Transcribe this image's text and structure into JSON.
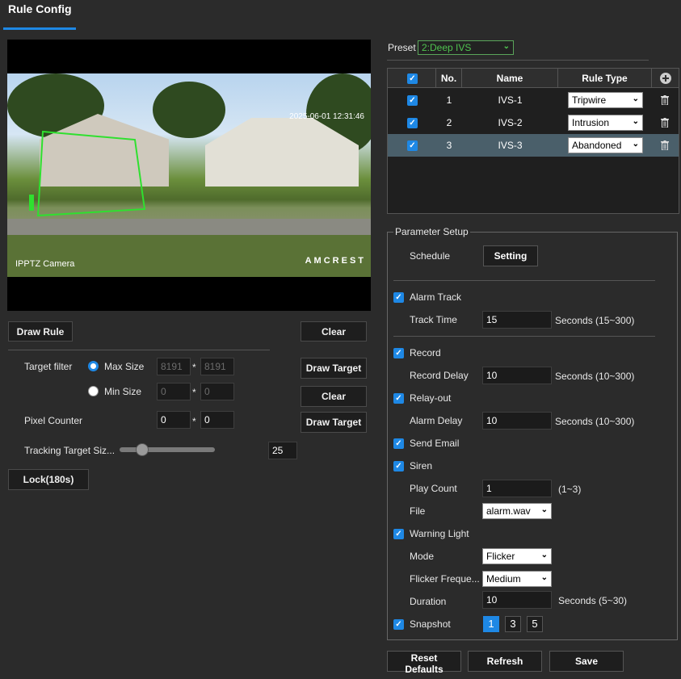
{
  "tab": {
    "title": "Rule Config"
  },
  "video": {
    "timestamp": "2025-06-01 12:31:46",
    "camera_name": "IPPTZ Camera",
    "logo": "AMCREST"
  },
  "left": {
    "draw_rule": "Draw Rule",
    "clear1": "Clear",
    "target_filter_label": "Target filter",
    "max_size_label": "Max Size",
    "min_size_label": "Min Size",
    "max_w": "8191",
    "max_h": "8191",
    "min_w": "0",
    "min_h": "0",
    "times": "*",
    "draw_target1": "Draw Target",
    "clear2": "Clear",
    "pixel_counter_label": "Pixel Counter",
    "pix_w": "0",
    "pix_h": "0",
    "draw_target2": "Draw Target",
    "tracking_label": "Tracking Target Siz...",
    "tracking_value": "25",
    "tracking_slider_fraction": 0.2,
    "lock_button": "Lock(180s)"
  },
  "preset": {
    "label": "Preset",
    "value": "2:Deep IVS"
  },
  "table": {
    "headers": {
      "no": "No.",
      "name": "Name",
      "type": "Rule Type"
    },
    "rows": [
      {
        "no": "1",
        "name": "IVS-1",
        "type": "Tripwire"
      },
      {
        "no": "2",
        "name": "IVS-2",
        "type": "Intrusion"
      },
      {
        "no": "3",
        "name": "IVS-3",
        "type": "Abandoned"
      }
    ]
  },
  "params": {
    "legend": "Parameter Setup",
    "schedule_label": "Schedule",
    "setting_btn": "Setting",
    "alarm_track": "Alarm Track",
    "track_time_label": "Track Time",
    "track_time": "15",
    "track_time_unit": "Seconds (15~300)",
    "record": "Record",
    "record_delay_label": "Record Delay",
    "record_delay": "10",
    "record_delay_unit": "Seconds (10~300)",
    "relay_out": "Relay-out",
    "alarm_delay_label": "Alarm Delay",
    "alarm_delay": "10",
    "alarm_delay_unit": "Seconds (10~300)",
    "send_email": "Send Email",
    "siren": "Siren",
    "play_count_label": "Play Count",
    "play_count": "1",
    "play_count_unit": "(1~3)",
    "file_label": "File",
    "file_value": "alarm.wav",
    "warning_light": "Warning Light",
    "mode_label": "Mode",
    "mode_value": "Flicker",
    "flicker_label": "Flicker Freque...",
    "flicker_value": "Medium",
    "duration_label": "Duration",
    "duration": "10",
    "duration_unit": "Seconds (5~30)",
    "snapshot": "Snapshot",
    "snap_options": [
      "1",
      "3",
      "5"
    ]
  },
  "footer": {
    "reset": "Reset Defaults",
    "refresh": "Refresh",
    "save": "Save"
  },
  "colors": {
    "accent": "#1e88e5",
    "rule_line": "#2fe02f",
    "selected_row": "#4a5f6a"
  }
}
